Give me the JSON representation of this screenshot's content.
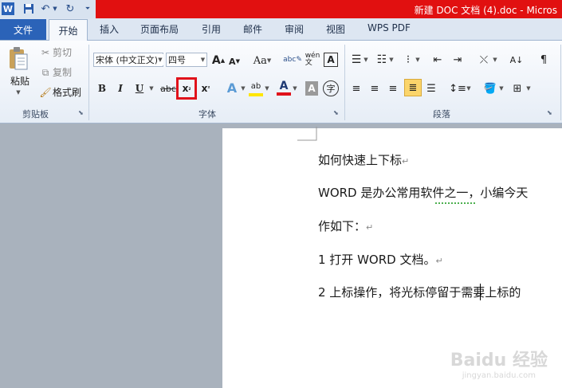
{
  "title_bar": {
    "doc_title": "新建 DOC 文档 (4).doc - Micros"
  },
  "qat": {
    "word_icon": "W"
  },
  "tabs": [
    "文件",
    "开始",
    "插入",
    "页面布局",
    "引用",
    "邮件",
    "审阅",
    "视图",
    "WPS PDF"
  ],
  "clipboard": {
    "paste": "粘贴",
    "cut": "剪切",
    "copy": "复制",
    "format_painter": "格式刷",
    "group_label": "剪贴板"
  },
  "font": {
    "font_name": "宋体 (中文正文)",
    "font_size": "四号",
    "group_label": "字体",
    "highlighted_button": "subscript"
  },
  "paragraph": {
    "group_label": "段落"
  },
  "colors": {
    "title_red": "#e11010",
    "file_tab_blue": "#2b63b8",
    "highlight_box": "#e0121b"
  },
  "document": {
    "lines": [
      "如何快速上下标",
      "WORD 是办公常用软件之一，小编今天",
      "作如下：",
      "1 打开 WORD 文档。",
      "2 上标操作，将光标停留于需要上标的"
    ]
  },
  "watermark": {
    "brand": "Baidu 经验",
    "url": "jingyan.baidu.com"
  }
}
